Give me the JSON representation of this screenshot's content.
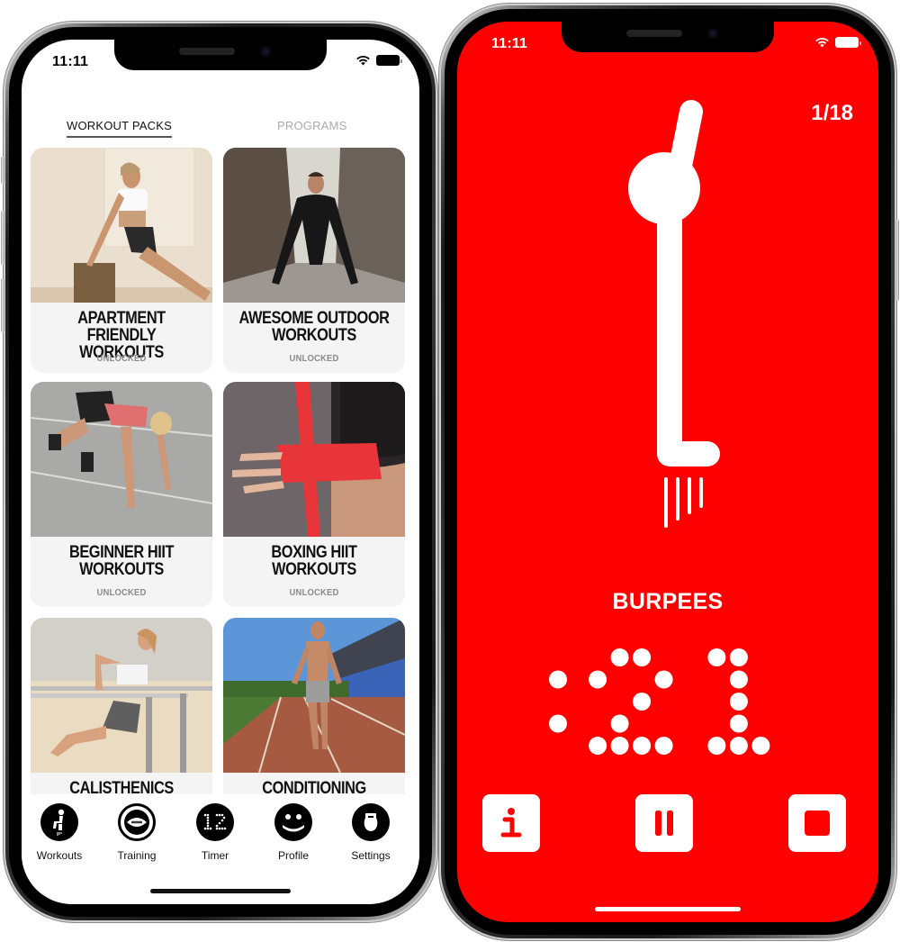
{
  "left_phone": {
    "status_bar": {
      "time": "11:11"
    },
    "top_tabs": [
      {
        "label": "WORKOUT PACKS",
        "active": true
      },
      {
        "label": "PROGRAMS",
        "active": false
      }
    ],
    "cards": [
      {
        "title": "APARTMENT FRIENDLY\nWORKOUTS",
        "status": "UNLOCKED",
        "image": "woman doing tricep dips on wooden box"
      },
      {
        "title": "AWESOME OUTDOOR\nWORKOUTS",
        "status": "UNLOCKED",
        "image": "man doing push-up in alley"
      },
      {
        "title": "BEGINNER HIIT\nWORKOUTS",
        "status": "UNLOCKED",
        "image": "woman in mountain climber position on track"
      },
      {
        "title": "BOXING HIIT\nWORKOUTS",
        "status": "UNLOCKED",
        "image": "woman wrapping hands with red boxing wraps"
      },
      {
        "title": "CALISTHENICS\nWORKOUTS",
        "status": "",
        "image": "woman doing dips on parallel bars on beach"
      },
      {
        "title": "CONDITIONING\nWORKOUTS",
        "status": "",
        "image": "man jumping rope on stadium track"
      }
    ],
    "tab_bar": [
      {
        "label": "Workouts",
        "icon": "workouts-figure-icon"
      },
      {
        "label": "Training",
        "icon": "training-football-icon"
      },
      {
        "label": "Timer",
        "icon": "timer-dots-icon"
      },
      {
        "label": "Profile",
        "icon": "smiley-face-icon"
      },
      {
        "label": "Settings",
        "icon": "kettlebell-icon"
      }
    ]
  },
  "right_phone": {
    "status_bar": {
      "time": "11:11"
    },
    "counter": "1/18",
    "exercise": "BURPEES",
    "timer": ":21",
    "accent_color": "#fe0000",
    "controls": [
      {
        "name": "info",
        "icon": "info-icon"
      },
      {
        "name": "pause",
        "icon": "pause-icon"
      },
      {
        "name": "stop",
        "icon": "stop-icon"
      }
    ]
  }
}
